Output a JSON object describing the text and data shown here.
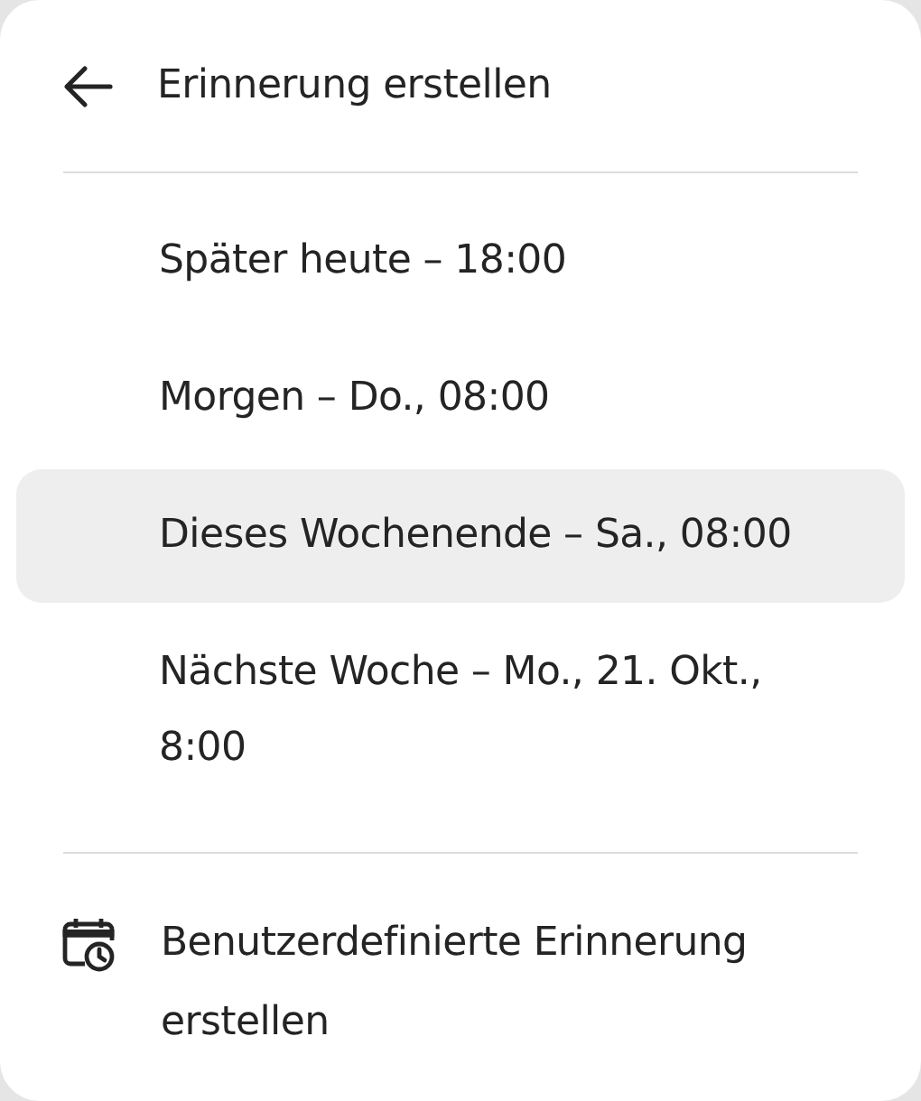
{
  "header": {
    "title": "Erinnerung erstellen"
  },
  "options": [
    {
      "label": "Später heute – 18:00",
      "selected": false
    },
    {
      "label": "Morgen – Do., 08:00",
      "selected": false
    },
    {
      "label": "Dieses Wochenende – Sa., 08:00",
      "selected": true
    },
    {
      "label": "Nächste Woche – Mo., 21. Okt., 8:00",
      "selected": false
    }
  ],
  "custom": {
    "label": "Benutzerdefinierte Erinnerung erstellen"
  }
}
